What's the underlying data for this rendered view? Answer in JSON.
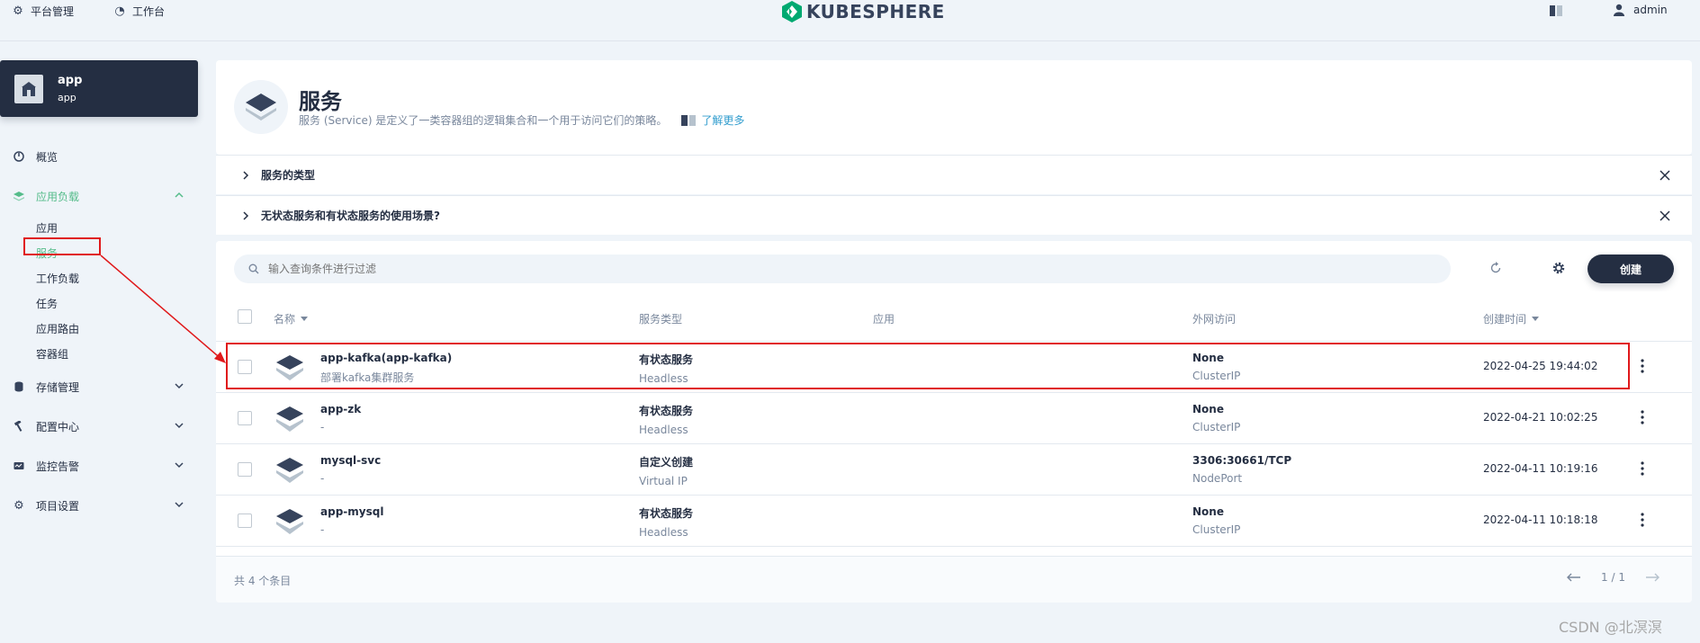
{
  "topbar": {
    "platform_label": "平台管理",
    "workbench_label": "工作台",
    "logo_text": "KUBESPHERE",
    "user_name": "admin"
  },
  "project": {
    "title": "app",
    "subtitle": "app"
  },
  "sidebar": {
    "overview": "概览",
    "workloads": {
      "label": "应用负载",
      "children": [
        "应用",
        "服务",
        "工作负载",
        "任务",
        "应用路由",
        "容器组"
      ]
    },
    "storage": "存储管理",
    "config": "配置中心",
    "monitoring": "监控告警",
    "settings": "项目设置"
  },
  "header": {
    "title": "服务",
    "description": "服务 (Service) 是定义了一类容器组的逻辑集合和一个用于访问它们的策略。",
    "learn_more": "了解更多"
  },
  "collapsibles": [
    "服务的类型",
    "无状态服务和有状态服务的使用场景?"
  ],
  "toolbar": {
    "search_placeholder": "输入查询条件进行过滤",
    "create_label": "创建"
  },
  "table": {
    "columns": {
      "name": "名称",
      "type": "服务类型",
      "app": "应用",
      "external": "外网访问",
      "created": "创建时间"
    },
    "rows": [
      {
        "name": "app-kafka(app-kafka)",
        "desc": "部署kafka集群服务",
        "type": "有状态服务",
        "type_sub": "Headless",
        "external": "None",
        "external_sub": "ClusterIP",
        "created": "2022-04-25 19:44:02"
      },
      {
        "name": "app-zk",
        "desc": "-",
        "type": "有状态服务",
        "type_sub": "Headless",
        "external": "None",
        "external_sub": "ClusterIP",
        "created": "2022-04-21 10:02:25"
      },
      {
        "name": "mysql-svc",
        "desc": "-",
        "type": "自定义创建",
        "type_sub": "Virtual IP",
        "external": "3306:30661/TCP",
        "external_sub": "NodePort",
        "created": "2022-04-11 10:19:16"
      },
      {
        "name": "app-mysql",
        "desc": "-",
        "type": "有状态服务",
        "type_sub": "Headless",
        "external": "None",
        "external_sub": "ClusterIP",
        "created": "2022-04-11 10:18:18"
      }
    ]
  },
  "footer": {
    "total": "共 4 个条目",
    "page": "1 / 1"
  },
  "watermark": "CSDN @北溟溟",
  "colors": {
    "accent": "#55bc8a",
    "dark": "#242e42",
    "annotation": "#e0191b",
    "link": "#329dce"
  }
}
